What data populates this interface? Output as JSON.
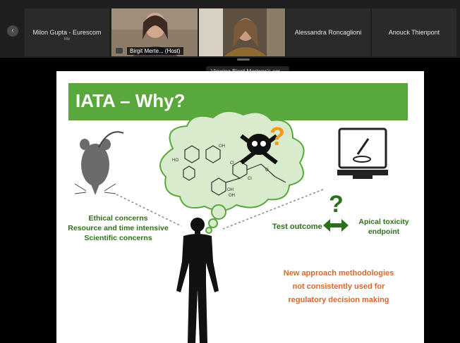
{
  "participants": [
    {
      "name": "Milon Gupta - Eurescom",
      "sub": "Me"
    },
    {
      "label": "Birgit Merte... (Host)"
    },
    {
      "label": ""
    },
    {
      "name": "Alessandra Roncaglioni"
    },
    {
      "name": "Anouck Thienpont"
    }
  ],
  "viewing_banner": "Viewing Birgit Mertens's scr...",
  "slide": {
    "title": "IATA – Why?",
    "left_lines": [
      "Ethical concerns",
      "Resource and time intensive",
      "Scientific concerns"
    ],
    "test_outcome": "Test outcome",
    "apical_lines": [
      "Apical toxicity",
      "endpoint"
    ],
    "question_mark": "?",
    "nam_lines": [
      "New approach methodologies",
      "not consistently used for",
      "regulatory decision making"
    ],
    "chem_labels": [
      "HO",
      "OH",
      "Cl",
      "Cl",
      "O",
      "OH",
      "OH"
    ]
  },
  "colors": {
    "slide_green": "#59a83b",
    "text_green": "#2e6f1e",
    "nam_orange": "#d8672c",
    "active_speaker": "#35a3e0"
  }
}
